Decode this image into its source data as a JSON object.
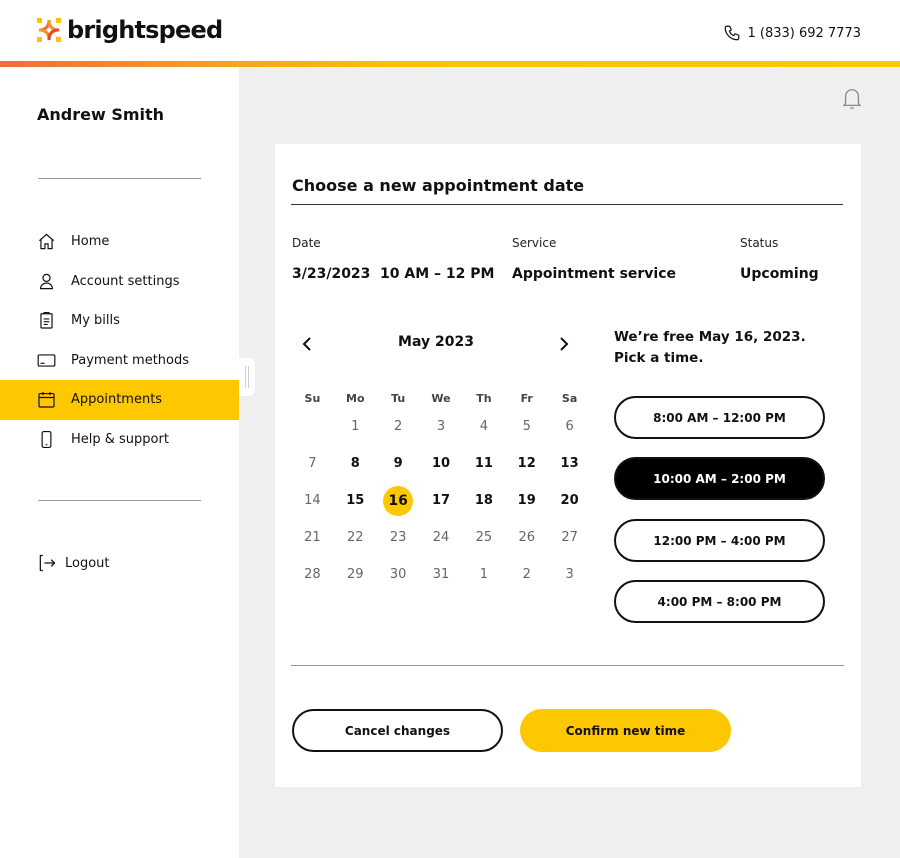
{
  "brand": {
    "name": "brightspeed",
    "accent": "#fec800",
    "gradient_start": "#f26b3a"
  },
  "header": {
    "phone_icon": "phone-icon",
    "phone": "1 (833) 692 7773"
  },
  "notifications": {
    "icon": "bell-icon"
  },
  "sidebar": {
    "user_name": "Andrew Smith",
    "items": [
      {
        "label": "Home",
        "icon": "home-icon",
        "active": false
      },
      {
        "label": "Account settings",
        "icon": "user-icon",
        "active": false
      },
      {
        "label": "My bills",
        "icon": "clipboard-icon",
        "active": false
      },
      {
        "label": "Payment methods",
        "icon": "credit-card-icon",
        "active": false
      },
      {
        "label": "Appointments",
        "icon": "calendar-icon",
        "active": true
      },
      {
        "label": "Help & support",
        "icon": "mobile-phone-icon",
        "active": false
      }
    ],
    "logout": {
      "label": "Logout",
      "icon": "logout-icon"
    }
  },
  "card": {
    "title": "Choose a new appointment date",
    "info": {
      "date_label": "Date",
      "date_value": "3/23/2023",
      "time_value": "10 AM – 12 PM",
      "service_label": "Service",
      "service_value": "Appointment service",
      "status_label": "Status",
      "status_value": "Upcoming"
    },
    "calendar": {
      "month": "May 2023",
      "prev_icon": "chevron-left-icon",
      "next_icon": "chevron-right-icon",
      "weekdays": [
        "Su",
        "Mo",
        "Tu",
        "We",
        "Th",
        "Fr",
        "Sa"
      ],
      "weeks": [
        [
          {
            "d": ""
          },
          {
            "d": "1"
          },
          {
            "d": "2"
          },
          {
            "d": "3"
          },
          {
            "d": "4"
          },
          {
            "d": "5"
          },
          {
            "d": "6"
          }
        ],
        [
          {
            "d": "7"
          },
          {
            "d": "8",
            "avail": true
          },
          {
            "d": "9",
            "avail": true
          },
          {
            "d": "10",
            "avail": true
          },
          {
            "d": "11",
            "avail": true
          },
          {
            "d": "12",
            "avail": true
          },
          {
            "d": "13",
            "avail": true
          }
        ],
        [
          {
            "d": "14"
          },
          {
            "d": "15",
            "avail": true
          },
          {
            "d": "16",
            "avail": true,
            "selected": true
          },
          {
            "d": "17",
            "avail": true
          },
          {
            "d": "18",
            "avail": true
          },
          {
            "d": "19",
            "avail": true
          },
          {
            "d": "20",
            "avail": true
          }
        ],
        [
          {
            "d": "21"
          },
          {
            "d": "22"
          },
          {
            "d": "23"
          },
          {
            "d": "24"
          },
          {
            "d": "25"
          },
          {
            "d": "26"
          },
          {
            "d": "27"
          }
        ],
        [
          {
            "d": "28"
          },
          {
            "d": "29"
          },
          {
            "d": "30"
          },
          {
            "d": "31"
          },
          {
            "d": "1"
          },
          {
            "d": "2"
          },
          {
            "d": "3"
          }
        ]
      ]
    },
    "free_line1": "We’re free May 16, 2023.",
    "free_line2": "Pick a time.",
    "slots": [
      {
        "label": "8:00 AM – 12:00 PM",
        "selected": false
      },
      {
        "label": "10:00 AM – 2:00 PM",
        "selected": true
      },
      {
        "label": "12:00 PM – 4:00 PM",
        "selected": false
      },
      {
        "label": "4:00 PM – 8:00 PM",
        "selected": false
      }
    ],
    "cancel_label": "Cancel changes",
    "confirm_label": "Confirm new time"
  }
}
